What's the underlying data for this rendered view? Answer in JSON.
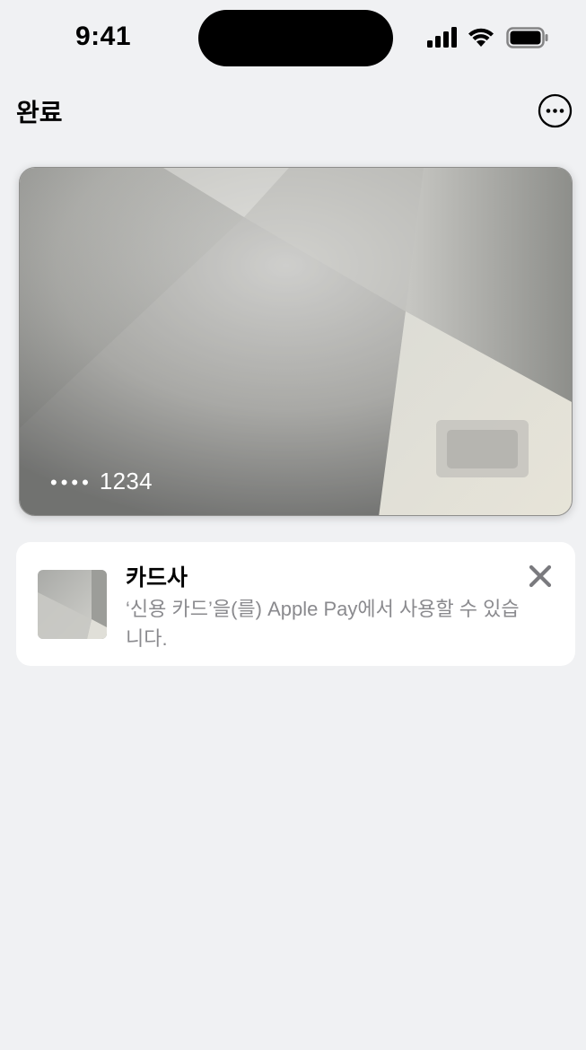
{
  "status_bar": {
    "time": "9:41",
    "icons": [
      "cellular-signal-icon",
      "wifi-icon",
      "battery-icon"
    ]
  },
  "nav": {
    "done_label": "완료",
    "more_icon": "ellipsis-circle-icon"
  },
  "card": {
    "masked_dots": "••••",
    "last_digits": "1234"
  },
  "notice": {
    "title": "카드사",
    "body": "‘신용 카드’을(를) Apple Pay에서 사용할 수 있습니다.",
    "close_icon": "close-icon"
  },
  "colors": {
    "background": "#f0f1f3",
    "card_base": "#bdbdb9",
    "notice_text": "#8a8a8e",
    "close_icon": "#7a7a7e"
  }
}
